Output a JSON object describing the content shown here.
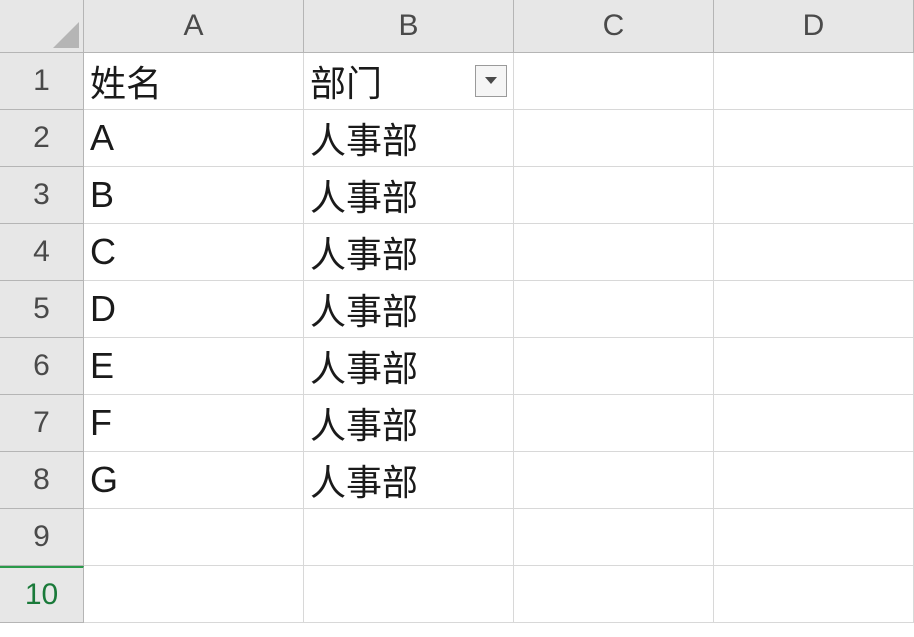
{
  "columns": [
    "A",
    "B",
    "C",
    "D"
  ],
  "row_numbers": [
    "1",
    "2",
    "3",
    "4",
    "5",
    "6",
    "7",
    "8",
    "9",
    "10"
  ],
  "selected_row_index": 9,
  "filter_on_column_index": 1,
  "cells": [
    {
      "r": 0,
      "c": 0,
      "v": "姓名"
    },
    {
      "r": 0,
      "c": 1,
      "v": "部门"
    },
    {
      "r": 1,
      "c": 0,
      "v": "A"
    },
    {
      "r": 1,
      "c": 1,
      "v": "人事部"
    },
    {
      "r": 2,
      "c": 0,
      "v": "B"
    },
    {
      "r": 2,
      "c": 1,
      "v": "人事部"
    },
    {
      "r": 3,
      "c": 0,
      "v": "C"
    },
    {
      "r": 3,
      "c": 1,
      "v": "人事部"
    },
    {
      "r": 4,
      "c": 0,
      "v": "D"
    },
    {
      "r": 4,
      "c": 1,
      "v": "人事部"
    },
    {
      "r": 5,
      "c": 0,
      "v": "E"
    },
    {
      "r": 5,
      "c": 1,
      "v": "人事部"
    },
    {
      "r": 6,
      "c": 0,
      "v": "F"
    },
    {
      "r": 6,
      "c": 1,
      "v": "人事部"
    },
    {
      "r": 7,
      "c": 0,
      "v": "G"
    },
    {
      "r": 7,
      "c": 1,
      "v": "人事部"
    }
  ]
}
